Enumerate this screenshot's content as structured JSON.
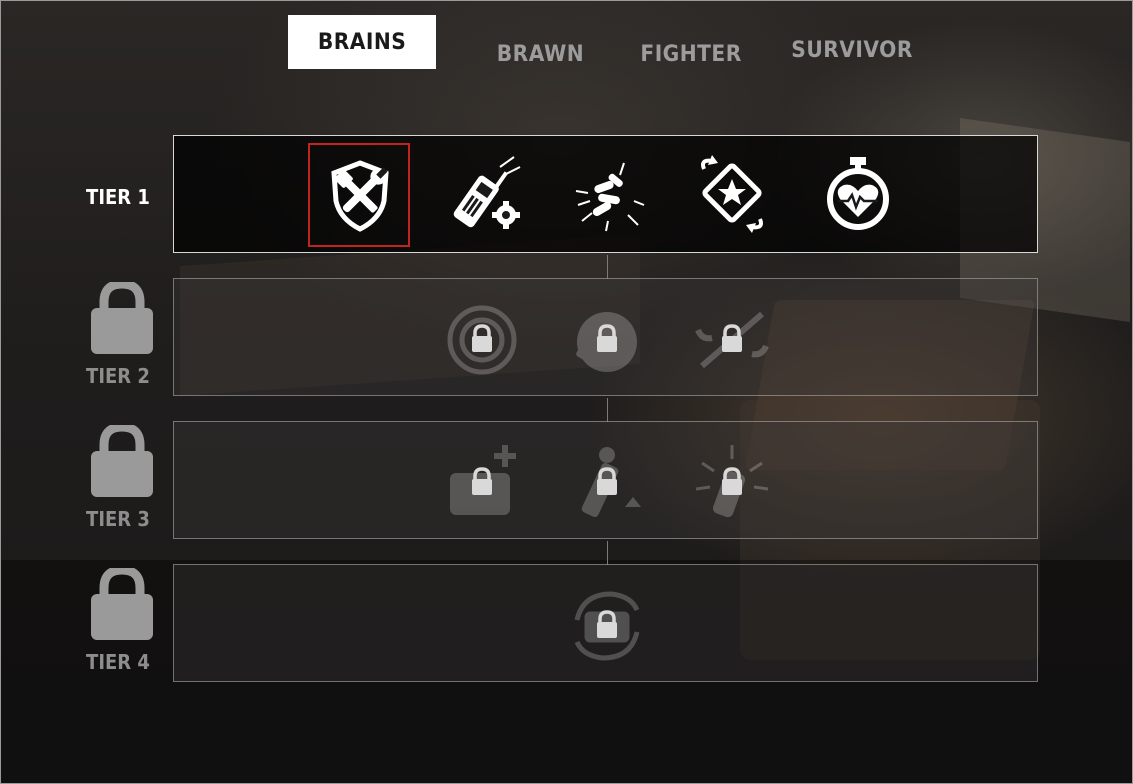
{
  "tabs": {
    "items": [
      {
        "label": "BRAINS",
        "active": true
      },
      {
        "label": "BRAWN",
        "active": false
      },
      {
        "label": "FIGHTER",
        "active": false
      },
      {
        "label": "SURVIVOR",
        "active": false
      }
    ]
  },
  "tiers": [
    {
      "label": "TIER 1",
      "locked": false,
      "skills": [
        {
          "icon": "repair-shield-icon",
          "selected": true,
          "locked": false
        },
        {
          "icon": "walkie-gear-icon",
          "selected": false,
          "locked": false
        },
        {
          "icon": "scattered-ammo-icon",
          "selected": false,
          "locked": false
        },
        {
          "icon": "star-card-swap-icon",
          "selected": false,
          "locked": false
        },
        {
          "icon": "heart-stopwatch-icon",
          "selected": false,
          "locked": false
        }
      ]
    },
    {
      "label": "TIER 2",
      "locked": true,
      "skills": [
        {
          "icon": "target-reticle-icon",
          "locked": true
        },
        {
          "icon": "radio-globe-icon",
          "locked": true
        },
        {
          "icon": "tool-swap-icon",
          "locked": true
        }
      ]
    },
    {
      "label": "TIER 3",
      "locked": true,
      "skills": [
        {
          "icon": "medkit-plus-icon",
          "locked": true
        },
        {
          "icon": "flask-upgrade-icon",
          "locked": true
        },
        {
          "icon": "explosive-burst-icon",
          "locked": true
        }
      ]
    },
    {
      "label": "TIER 4",
      "locked": true,
      "skills": [
        {
          "icon": "cycle-stash-icon",
          "locked": true
        }
      ]
    }
  ],
  "colors": {
    "selection_border": "#c0241c",
    "active_tab_bg": "#ffffff",
    "inactive_text": "#9c9c9c",
    "lock_gray": "#9a9a9a"
  }
}
